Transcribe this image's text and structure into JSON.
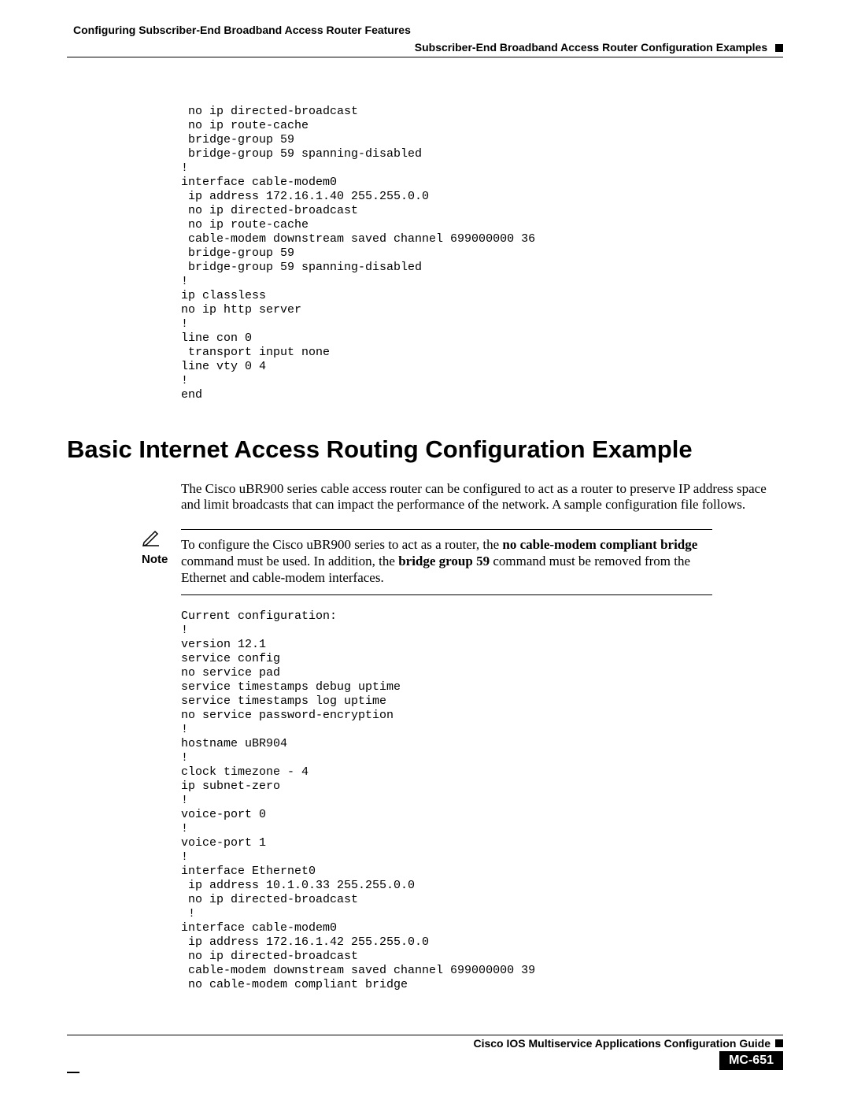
{
  "header": {
    "chapter": "Configuring Subscriber-End Broadband Access Router Features",
    "section": "Subscriber-End Broadband Access Router Configuration Examples"
  },
  "code1": " no ip directed-broadcast\n no ip route-cache\n bridge-group 59\n bridge-group 59 spanning-disabled\n!\ninterface cable-modem0\n ip address 172.16.1.40 255.255.0.0\n no ip directed-broadcast\n no ip route-cache\n cable-modem downstream saved channel 699000000 36\n bridge-group 59\n bridge-group 59 spanning-disabled\n!\nip classless\nno ip http server\n!\nline con 0\n transport input none\nline vty 0 4\n!\nend",
  "heading": "Basic Internet Access Routing Configuration Example",
  "para1": "The Cisco uBR900 series cable access router can be configured to act as a router to preserve IP address space and limit broadcasts that can impact the performance of the network. A sample configuration file follows.",
  "note": {
    "label": "Note",
    "pre1": "To configure the Cisco uBR900 series to act as a router, the ",
    "bold1": "no cable-modem compliant bridge",
    "mid1": " command must be used. In addition, the ",
    "bold2": "bridge group 59",
    "post1": " command must be removed from the Ethernet and cable-modem interfaces."
  },
  "code2": "Current configuration:\n!\nversion 12.1\nservice config\nno service pad\nservice timestamps debug uptime\nservice timestamps log uptime\nno service password-encryption\n!\nhostname uBR904\n!\nclock timezone - 4\nip subnet-zero\n!\nvoice-port 0\n!\nvoice-port 1\n!\ninterface Ethernet0\n ip address 10.1.0.33 255.255.0.0\n no ip directed-broadcast\n !\ninterface cable-modem0\n ip address 172.16.1.42 255.255.0.0\n no ip directed-broadcast\n cable-modem downstream saved channel 699000000 39\n no cable-modem compliant bridge",
  "footer": {
    "guide": "Cisco IOS Multiservice Applications Configuration Guide",
    "page": "MC-651"
  }
}
